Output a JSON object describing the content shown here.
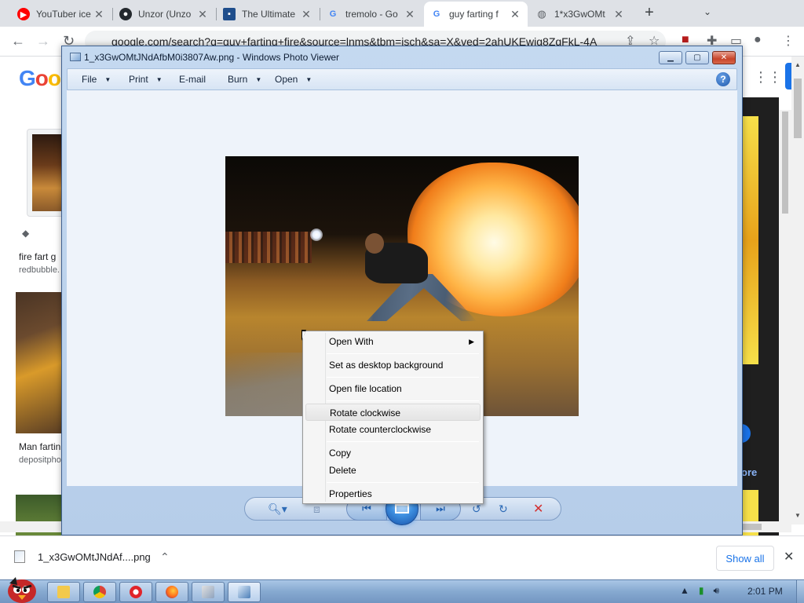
{
  "browser": {
    "tabs": [
      {
        "title": "YouTuber ice",
        "favicon": "youtube-icon",
        "color": "#ff0000"
      },
      {
        "title": "Unzor (Unzo",
        "favicon": "github-icon",
        "color": "#24292e"
      },
      {
        "title": "The Ultimate",
        "favicon": "site-icon",
        "color": "#1f4e8c"
      },
      {
        "title": "tremolo - Go",
        "favicon": "google-icon",
        "color": "#4285f4"
      },
      {
        "title": "guy farting f",
        "favicon": "google-icon",
        "color": "#4285f4"
      },
      {
        "title": "1*x3GwOMt",
        "favicon": "globe-icon",
        "color": "#5f6368"
      }
    ],
    "url": "google.com/search?q=guy+farting+fire&source=lnms&tbm=isch&sa=X&ved=2ahUKEwig8ZqFkL-4A"
  },
  "google": {
    "logo": "Goo",
    "results": [
      {
        "title": "fire fart g",
        "source": "redbubble."
      },
      {
        "title": "Man fartin",
        "source": "depositpho"
      }
    ],
    "right_more": "ore"
  },
  "photo_viewer": {
    "title": "1_x3GwOMtJNdAfbM0i3807Aw.png - Windows Photo Viewer",
    "menu": [
      "File",
      "Print",
      "E-mail",
      "Burn",
      "Open"
    ],
    "help": "?"
  },
  "context_menu": {
    "items": [
      "Open With",
      "Set as desktop background",
      "Open file location",
      "Rotate clockwise",
      "Rotate counterclockwise",
      "Copy",
      "Delete",
      "Properties"
    ]
  },
  "downloads": {
    "filename": "1_x3GwOMtJNdAf....png",
    "show_all": "Show all"
  },
  "taskbar": {
    "clock": "2:01 PM"
  },
  "colors": {
    "chrome_frame": "#dee1e6",
    "link_blue": "#1a73e8",
    "viewer_frame": "#c4d9f0",
    "taskbar": "#86a9d0",
    "delete_red": "#d32f2f"
  }
}
